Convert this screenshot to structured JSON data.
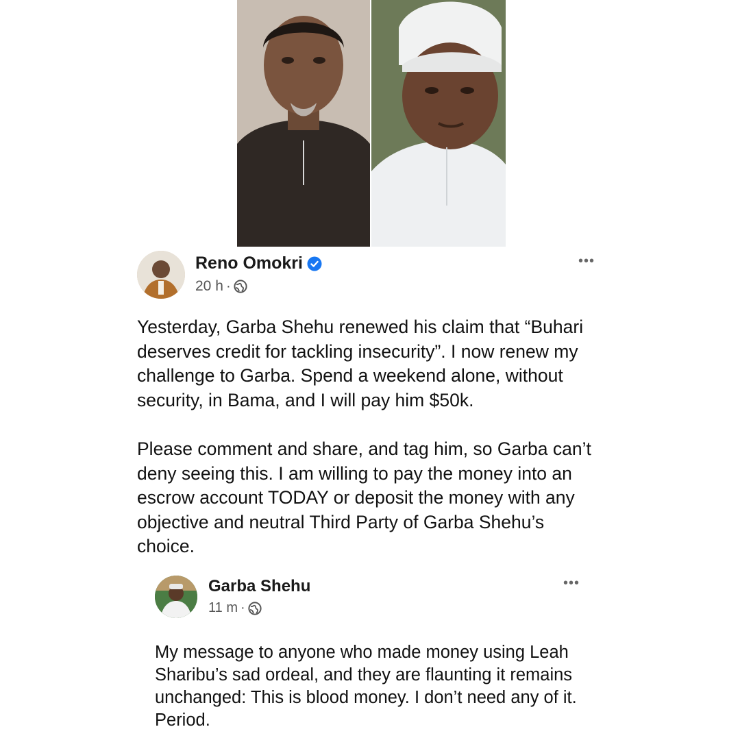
{
  "post": {
    "author": "Reno Omokri",
    "time": "20 h",
    "separator": "·",
    "more_label": "•••",
    "paragraphs": [
      "Yesterday, Garba Shehu renewed his claim that “Buhari deserves credit for tackling insecurity”. I now renew my challenge to Garba. Spend a weekend alone, without security, in Bama, and I will pay him $50k.",
      "Please comment and share, and tag him, so Garba can’t deny seeing this. I am willing to pay the money into an escrow account TODAY or deposit the money with any objective and neutral Third Party of Garba Shehu’s choice."
    ],
    "verified_icon": "verified-badge-icon",
    "privacy_icon": "globe-icon"
  },
  "reply": {
    "author": "Garba Shehu",
    "time": "11 m",
    "separator": "·",
    "more_label": "•••",
    "body": "My message to anyone who made money using Leah Sharibu’s sad ordeal, and they are flaunting it remains unchanged: This is blood money. I don’t need any of it. Period.",
    "privacy_icon": "globe-icon"
  },
  "colors": {
    "text": "#111111",
    "meta": "#555555",
    "verified": "#1877f2"
  }
}
